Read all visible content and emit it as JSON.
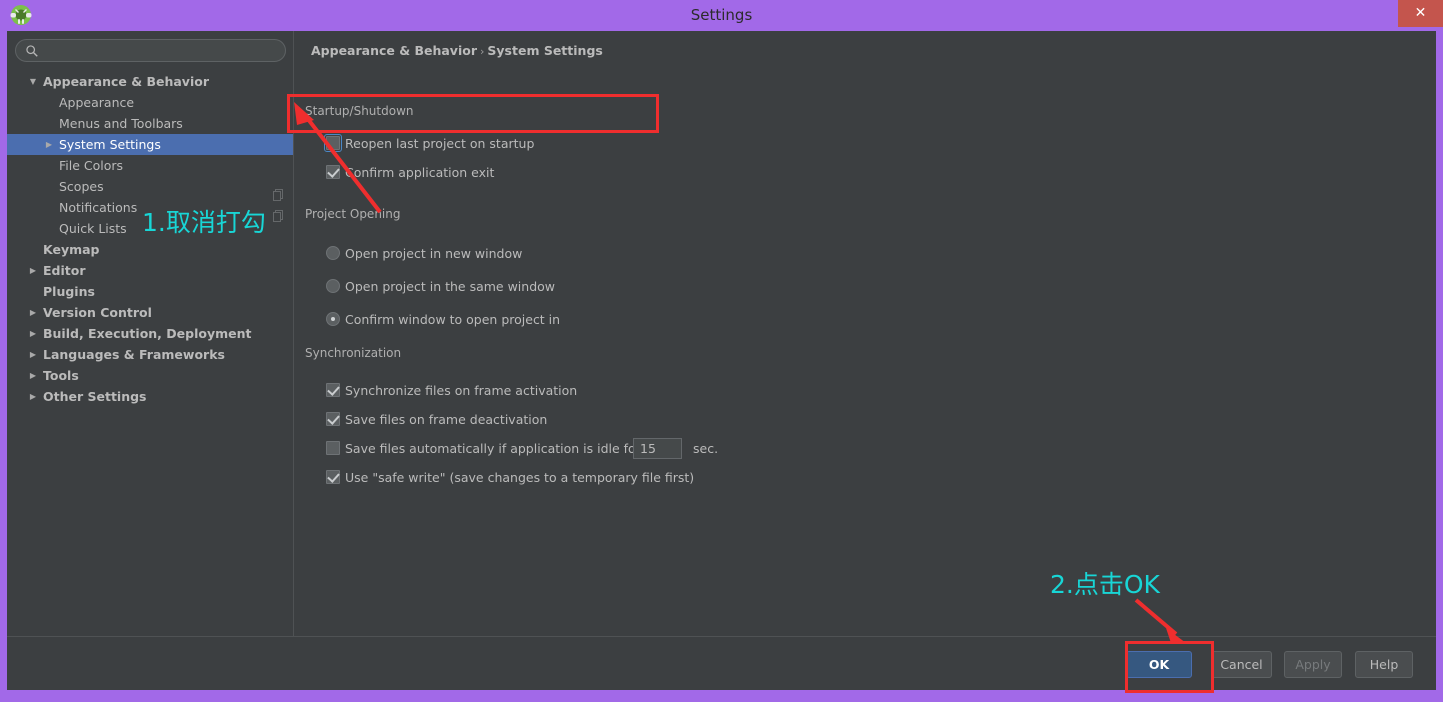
{
  "window": {
    "title": "Settings",
    "app_icon": "android-studio-icon",
    "close_label": "✕",
    "accent_purple": "#a269e8",
    "bg": "#3c3f41",
    "selection_blue": "#4b6eaf"
  },
  "search": {
    "value": "",
    "placeholder": "",
    "icon": "search-icon"
  },
  "sidebar": {
    "items": [
      {
        "label": "Appearance & Behavior",
        "level": 0,
        "twisty": "▼",
        "selected": false,
        "bold": true
      },
      {
        "label": "Appearance",
        "level": 1,
        "twisty": "",
        "selected": false,
        "bold": false
      },
      {
        "label": "Menus and Toolbars",
        "level": 1,
        "twisty": "",
        "selected": false,
        "bold": false
      },
      {
        "label": "System Settings",
        "level": 1,
        "twisty": "▶",
        "selected": true,
        "bold": false
      },
      {
        "label": "File Colors",
        "level": 1,
        "twisty": "",
        "selected": false,
        "bold": false
      },
      {
        "label": "Scopes",
        "level": 1,
        "twisty": "",
        "selected": false,
        "bold": false
      },
      {
        "label": "Notifications",
        "level": 1,
        "twisty": "",
        "selected": false,
        "bold": false
      },
      {
        "label": "Quick Lists",
        "level": 1,
        "twisty": "",
        "selected": false,
        "bold": false
      },
      {
        "label": "Keymap",
        "level": 0,
        "twisty": "",
        "selected": false,
        "bold": true
      },
      {
        "label": "Editor",
        "level": 0,
        "twisty": "▶",
        "selected": false,
        "bold": true
      },
      {
        "label": "Plugins",
        "level": 0,
        "twisty": "",
        "selected": false,
        "bold": true
      },
      {
        "label": "Version Control",
        "level": 0,
        "twisty": "▶",
        "selected": false,
        "bold": true
      },
      {
        "label": "Build, Execution, Deployment",
        "level": 0,
        "twisty": "▶",
        "selected": false,
        "bold": true
      },
      {
        "label": "Languages & Frameworks",
        "level": 0,
        "twisty": "▶",
        "selected": false,
        "bold": true
      },
      {
        "label": "Tools",
        "level": 0,
        "twisty": "▶",
        "selected": false,
        "bold": true
      },
      {
        "label": "Other Settings",
        "level": 0,
        "twisty": "▶",
        "selected": false,
        "bold": true
      }
    ]
  },
  "breadcrumb": {
    "root": "Appearance & Behavior",
    "separator": "›",
    "leaf": "System Settings"
  },
  "sections": {
    "startup": {
      "title": "Startup/Shutdown",
      "rows": [
        {
          "label": "Reopen last project on startup",
          "type": "checkbox",
          "checked": false,
          "focused": true
        },
        {
          "label": "Confirm application exit",
          "type": "checkbox",
          "checked": true,
          "focused": false
        }
      ]
    },
    "project_opening": {
      "title": "Project Opening",
      "rows": [
        {
          "label": "Open project in new window",
          "type": "radio",
          "checked": false
        },
        {
          "label": "Open project in the same window",
          "type": "radio",
          "checked": false
        },
        {
          "label": "Confirm window to open project in",
          "type": "radio",
          "checked": true
        }
      ]
    },
    "synchronization": {
      "title": "Synchronization",
      "rows": [
        {
          "label": "Synchronize files on frame activation",
          "type": "checkbox",
          "checked": true
        },
        {
          "label": "Save files on frame deactivation",
          "type": "checkbox",
          "checked": true
        },
        {
          "label": "Save files automatically if application is idle for",
          "type": "checkbox",
          "checked": false,
          "field_value": "15",
          "unit": "sec."
        },
        {
          "label": "Use \"safe write\" (save changes to a temporary file first)",
          "type": "checkbox",
          "checked": true
        }
      ]
    }
  },
  "buttons": {
    "ok": "OK",
    "cancel": "Cancel",
    "apply": "Apply",
    "help": "Help"
  },
  "annotations": {
    "step1_text": "1.取消打勾",
    "step2_text": "2.点击OK",
    "highlight_color": "#ef2e2e",
    "text_color": "#18d6d6"
  }
}
